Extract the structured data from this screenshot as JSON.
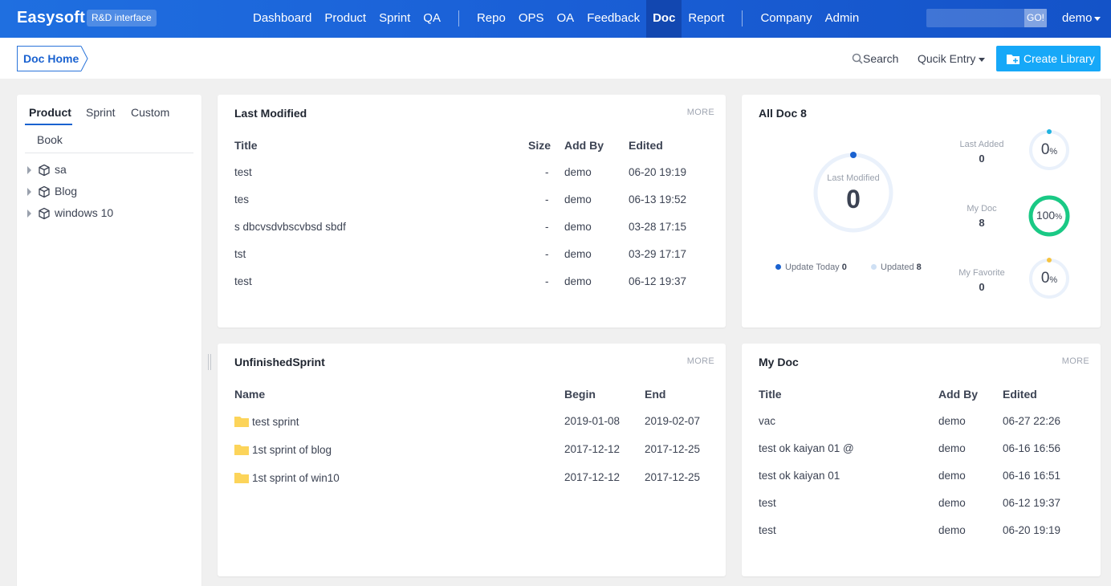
{
  "header": {
    "brand": "Easysoft",
    "badge": "R&D interface",
    "nav_main": [
      "Dashboard",
      "Product",
      "Sprint",
      "QA"
    ],
    "nav_mid": [
      "Repo",
      "OPS",
      "OA",
      "Feedback",
      "Doc",
      "Report"
    ],
    "nav_end": [
      "Company",
      "Admin"
    ],
    "active_nav": "Doc",
    "search_placeholder": "",
    "go_label": "GO!",
    "user": "demo",
    "colors": {
      "bar": "#1a5fd6",
      "active": "#1247b0"
    }
  },
  "subheader": {
    "doc_home": "Doc Home",
    "search": "Search",
    "quick_entry": "Qucik Entry",
    "create_library": "Create Library"
  },
  "sidebar": {
    "tabs": [
      "Product",
      "Sprint",
      "Custom",
      "Book"
    ],
    "active_tab": "Product",
    "items": [
      {
        "label": "sa"
      },
      {
        "label": "Blog"
      },
      {
        "label": "windows 10"
      }
    ]
  },
  "last_modified": {
    "title": "Last Modified",
    "more": "MORE",
    "columns": [
      "Title",
      "Size",
      "Add By",
      "Edited"
    ],
    "rows": [
      {
        "title": "test",
        "size": "-",
        "add_by": "demo",
        "edited": "06-20 19:19"
      },
      {
        "title": "tes",
        "size": "-",
        "add_by": "demo",
        "edited": "06-13 19:52"
      },
      {
        "title": "s dbcvsdvbscvbsd sbdf",
        "size": "-",
        "add_by": "demo",
        "edited": "03-28 17:15"
      },
      {
        "title": "tst",
        "size": "-",
        "add_by": "demo",
        "edited": "03-29 17:17"
      },
      {
        "title": "test",
        "size": "-",
        "add_by": "demo",
        "edited": "06-12 19:37"
      }
    ]
  },
  "all_doc": {
    "title": "All Doc 8",
    "center_label": "Last Modified",
    "center_value": "0",
    "legend_today": "Update Today",
    "legend_today_value": "0",
    "legend_updated": "Updated",
    "legend_updated_value": "8",
    "stats": [
      {
        "label": "Last Added",
        "value": "0",
        "percent": "0",
        "unit": "%",
        "color": "#1fb3e0",
        "fraction": 0
      },
      {
        "label": "My Doc",
        "value": "8",
        "percent": "100",
        "unit": "%",
        "color": "#1ac985",
        "fraction": 1
      },
      {
        "label": "My Favorite",
        "value": "0",
        "percent": "0",
        "unit": "%",
        "color": "#f6c33f",
        "fraction": 0
      }
    ]
  },
  "unfinished_sprint": {
    "title": "UnfinishedSprint",
    "more": "MORE",
    "columns": [
      "Name",
      "Begin",
      "End"
    ],
    "rows": [
      {
        "name": "test sprint",
        "begin": "2019-01-08",
        "end": "2019-02-07"
      },
      {
        "name": "1st sprint of blog",
        "begin": "2017-12-12",
        "end": "2017-12-25"
      },
      {
        "name": "1st sprint of win10",
        "begin": "2017-12-12",
        "end": "2017-12-25"
      }
    ]
  },
  "my_doc": {
    "title": "My Doc",
    "more": "MORE",
    "columns": [
      "Title",
      "Add By",
      "Edited"
    ],
    "rows": [
      {
        "title": "vac",
        "add_by": "demo",
        "edited": "06-27 22:26"
      },
      {
        "title": "test ok kaiyan 01 @",
        "add_by": "demo",
        "edited": "06-16 16:56"
      },
      {
        "title": "test ok kaiyan 01",
        "add_by": "demo",
        "edited": "06-16 16:51"
      },
      {
        "title": "test",
        "add_by": "demo",
        "edited": "06-12 19:37"
      },
      {
        "title": "test",
        "add_by": "demo",
        "edited": "06-20 19:19"
      }
    ]
  }
}
